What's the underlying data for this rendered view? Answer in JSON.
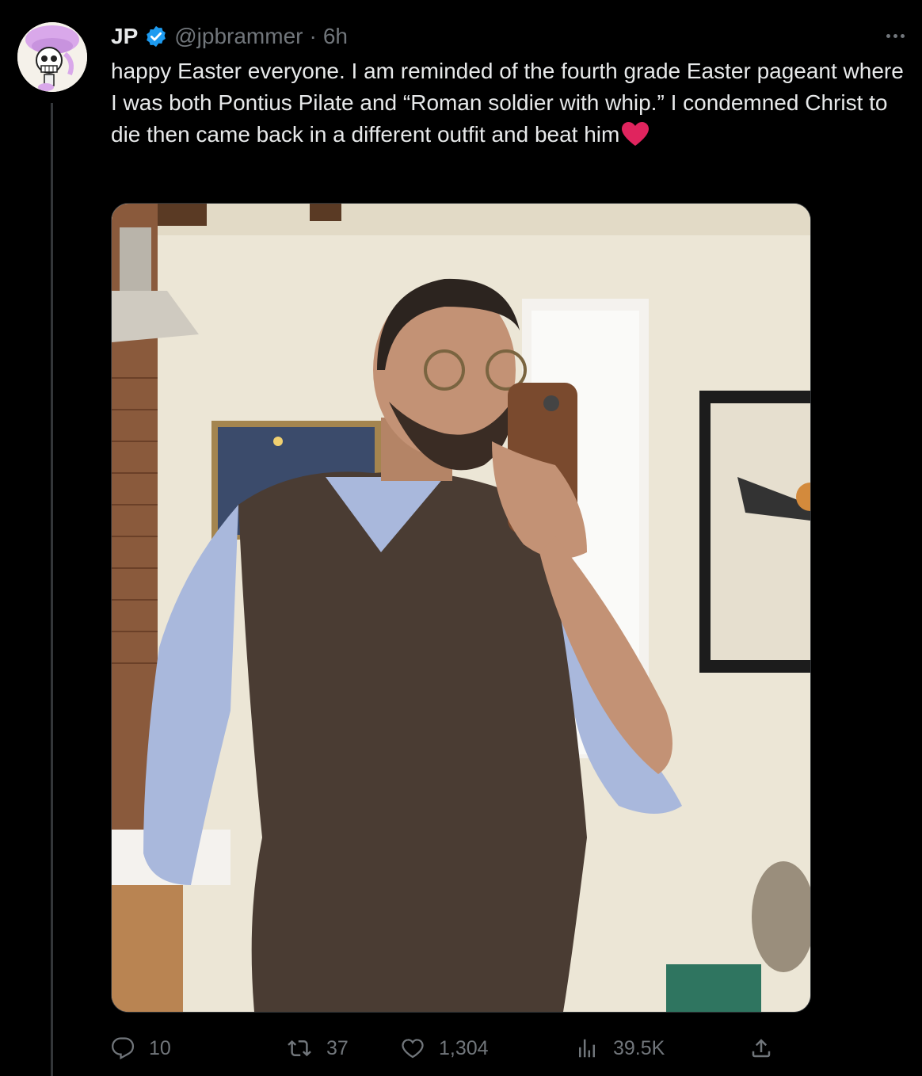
{
  "tweet": {
    "author_name": "JP",
    "handle": "@jpbrammer",
    "separator": "·",
    "time": "6h",
    "text": "happy Easter everyone. I am reminded of the fourth grade Easter pageant where I was both Pontius Pilate and “Roman soldier with whip.” I condemned Christ to die then came back in a different outfit and beat him",
    "trailing_emoji": "red-heart-icon"
  },
  "actions": {
    "replies": "10",
    "retweets": "37",
    "likes": "1,304",
    "views": "39.5K"
  },
  "colors": {
    "background": "#000000",
    "text": "#e7e9ea",
    "muted": "#71767b",
    "verified": "#1d9bf0",
    "avatar_accent": "#d7a7e8",
    "heart": "#e0245e"
  }
}
